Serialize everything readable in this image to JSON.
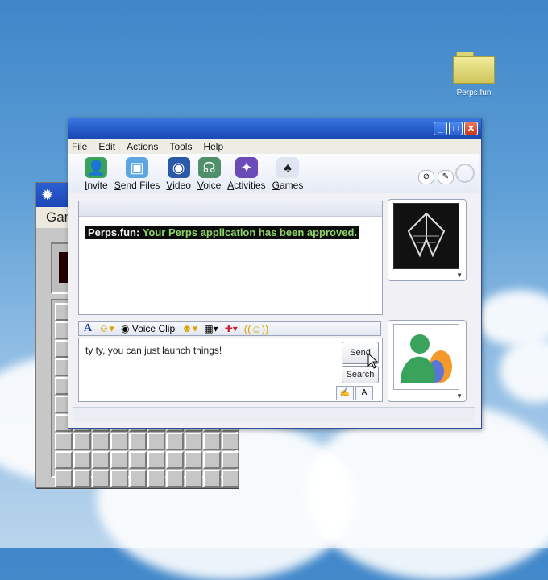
{
  "desktop": {
    "icon_label": "Perps.fun"
  },
  "minesweeper": {
    "menu_label": "Gam",
    "counter": "0",
    "grid_rows": 10,
    "grid_cols": 10
  },
  "window": {
    "menu": [
      "File",
      "Edit",
      "Actions",
      "Tools",
      "Help"
    ],
    "toolbar": [
      "Invite",
      "Send Files",
      "Video",
      "Voice",
      "Activities",
      "Games"
    ],
    "conversation": {
      "sender": "Perps.fun:",
      "message": "Your Perps application has been approved."
    },
    "emoticon_bar": {
      "voice_clip_label": "Voice Clip"
    },
    "input": {
      "text": "ty ty, you can just launch things!",
      "send_label": "Send",
      "search_label": "Search"
    }
  },
  "colors": {
    "title_bar": "#2257c4",
    "message_highlight": "#0d0d0d",
    "message_text": "#8fd46b",
    "close_button": "#c8381c"
  }
}
